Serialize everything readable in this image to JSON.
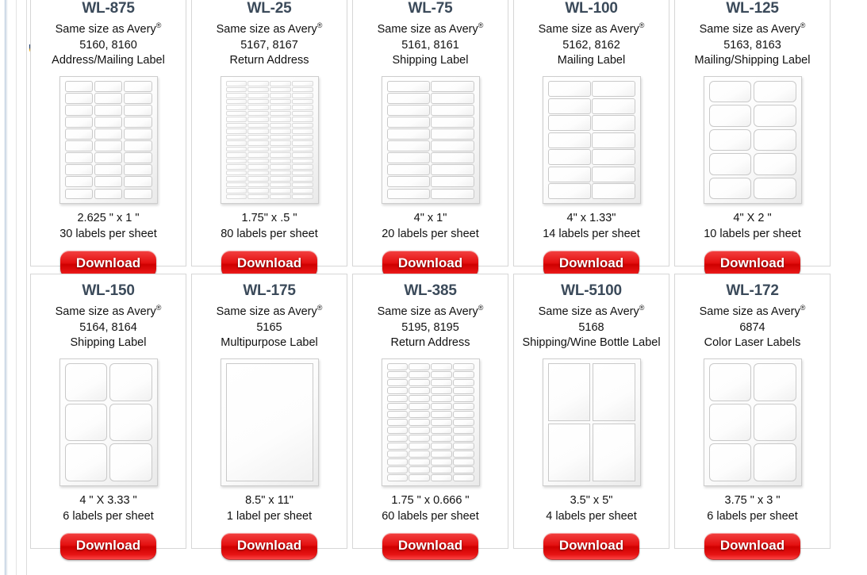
{
  "page": {
    "avery_note_prefix": "Same size as Avery",
    "registered_mark": "®",
    "download_label": "Download"
  },
  "products": [
    {
      "sku": "WL-875",
      "avery_note": "Same size as Avery",
      "avery_codes": "5160, 8160",
      "label_type": "Address/Mailing Label",
      "dimensions": "2.625 \" x 1 \"",
      "per_sheet": "30 labels per sheet",
      "download_label": "Download",
      "sheet": {
        "cols": 3,
        "rows": 10,
        "style": "round"
      }
    },
    {
      "sku": "WL-25",
      "avery_note": "Same size as Avery",
      "avery_codes": "5167, 8167",
      "label_type": "Return Address",
      "dimensions": "1.75\" x .5 \"",
      "per_sheet": "80 labels per sheet",
      "download_label": "Download",
      "sheet": {
        "cols": 4,
        "rows": 20,
        "style": "plain"
      }
    },
    {
      "sku": "WL-75",
      "avery_note": "Same size as Avery",
      "avery_codes": "5161, 8161",
      "label_type": "Shipping Label",
      "dimensions": "4\" x 1\"",
      "per_sheet": "20 labels per sheet",
      "download_label": "Download",
      "sheet": {
        "cols": 2,
        "rows": 10,
        "style": "round"
      }
    },
    {
      "sku": "WL-100",
      "avery_note": "Same size as Avery",
      "avery_codes": "5162, 8162",
      "label_type": "Mailing Label",
      "dimensions": "4\" x 1.33\"",
      "per_sheet": "14 labels per sheet",
      "download_label": "Download",
      "sheet": {
        "cols": 2,
        "rows": 7,
        "style": "round"
      }
    },
    {
      "sku": "WL-125",
      "avery_note": "Same size as Avery",
      "avery_codes": "5163, 8163",
      "label_type": "Mailing/Shipping Label",
      "dimensions": "4\" X 2 \"",
      "per_sheet": "10 labels per sheet",
      "download_label": "Download",
      "sheet": {
        "cols": 2,
        "rows": 5,
        "style": "round-lg"
      }
    },
    {
      "sku": "WL-150",
      "avery_note": "Same size as Avery",
      "avery_codes": "5164, 8164",
      "label_type": "Shipping Label",
      "dimensions": "4 \" X 3.33 \"",
      "per_sheet": "6 labels per sheet",
      "download_label": "Download",
      "sheet": {
        "cols": 2,
        "rows": 3,
        "style": "round-lg"
      }
    },
    {
      "sku": "WL-175",
      "avery_note": "Same size as Avery",
      "avery_codes": "5165",
      "label_type": "Multipurpose Label",
      "dimensions": "8.5\" x 11\"",
      "per_sheet": "1 label per sheet",
      "download_label": "Download",
      "sheet": {
        "cols": 1,
        "rows": 1,
        "style": "sharp"
      }
    },
    {
      "sku": "WL-385",
      "avery_note": "Same size as Avery",
      "avery_codes": "5195, 8195",
      "label_type": "Return Address",
      "dimensions": "1.75 \" x 0.666 \"",
      "per_sheet": "60 labels per sheet",
      "download_label": "Download",
      "sheet": {
        "cols": 4,
        "rows": 15,
        "style": "round"
      }
    },
    {
      "sku": "WL-5100",
      "avery_note": "Same size as Avery",
      "avery_codes": "5168",
      "label_type": "Shipping/Wine Bottle Label",
      "dimensions": "3.5\" x 5\"",
      "per_sheet": "4 labels per sheet",
      "download_label": "Download",
      "sheet": {
        "cols": 2,
        "rows": 2,
        "style": "sharp"
      }
    },
    {
      "sku": "WL-172",
      "avery_note": "Same size as Avery",
      "avery_codes": "6874",
      "label_type": "Color Laser Labels",
      "dimensions": "3.75 \" x 3 \"",
      "per_sheet": "6 labels per sheet",
      "download_label": "Download",
      "sheet": {
        "cols": 2,
        "rows": 3,
        "style": "round-lg"
      }
    }
  ]
}
